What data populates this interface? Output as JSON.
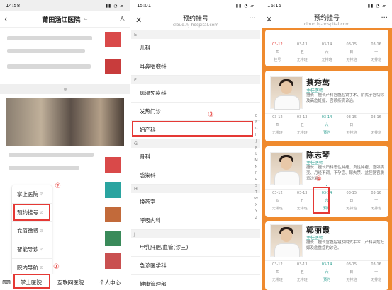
{
  "panel1": {
    "status_time": "14:58",
    "nav_title": "莆田涵江医院",
    "menu_items": [
      "掌上医院",
      "预约挂号",
      "充值缴费",
      "智能导诊",
      "院内导航"
    ],
    "tabs": [
      "掌上医院",
      "互联网医院",
      "个人中心"
    ],
    "num1": "①",
    "num2": "②"
  },
  "panel2": {
    "status_time": "15:01",
    "nav_title": "预约挂号",
    "nav_url": "cloud.hj-hospital.com",
    "sections": [
      {
        "letter": "E",
        "items": [
          "儿科",
          "耳鼻咽喉科"
        ]
      },
      {
        "letter": "F",
        "items": [
          "风湿免疫科",
          "发热门诊",
          "妇产科"
        ]
      },
      {
        "letter": "G",
        "items": [
          "骨科",
          "感染科"
        ]
      },
      {
        "letter": "H",
        "items": [
          "换药室",
          "呼吸内科"
        ]
      },
      {
        "letter": "J",
        "items": [
          "甲乳肝胆/血管(诊三)",
          "急诊医学科",
          "健康管理部"
        ]
      }
    ],
    "index_letters": [
      "E",
      "F",
      "G",
      "H",
      "J",
      "K",
      "L",
      "M",
      "N",
      "P",
      "R",
      "S",
      "T",
      "W",
      "X",
      "Y",
      "Z"
    ],
    "num3": "③"
  },
  "panel3": {
    "status_time": "16:15",
    "nav_title": "预约挂号",
    "nav_url": "cloud.hj-hospital.com",
    "num4": "④",
    "top_schedule": [
      {
        "date": "03-12",
        "day": "四",
        "status": "挂号"
      },
      {
        "date": "03-13",
        "day": "五",
        "status": "无排班"
      },
      {
        "date": "03-14",
        "day": "六",
        "status": "无排班"
      },
      {
        "date": "03-15",
        "day": "日",
        "status": "无排班"
      },
      {
        "date": "03-16",
        "day": "一",
        "status": "无排班"
      }
    ],
    "doctors": [
      {
        "name": "蔡秀莺",
        "title": "主任医师",
        "specialty": "擅长：擅长产科宫腹腔镜手术、阴式子宫切除及高危妊娠、宫颈疾病诊治。",
        "schedule": [
          {
            "date": "03-12",
            "day": "四",
            "status": "无排班"
          },
          {
            "date": "03-13",
            "day": "五",
            "status": "无排班"
          },
          {
            "date": "03-14",
            "day": "六",
            "status": "预约"
          },
          {
            "date": "03-15",
            "day": "日",
            "status": "无排班"
          },
          {
            "date": "03-16",
            "day": "一",
            "status": "无排班"
          }
        ]
      },
      {
        "name": "陈志琴",
        "title": "主任医师",
        "specialty": "擅长：擅长妇科恶性肿瘤、良性肿瘤、宫颈病变、月经不调、不孕症、尿失禁、盆腔器官脱垂诊治。",
        "schedule": [
          {
            "date": "03-12",
            "day": "四",
            "status": "无排班"
          },
          {
            "date": "03-13",
            "day": "五",
            "status": "无排班"
          },
          {
            "date": "03-14",
            "day": "六",
            "status": "预约"
          },
          {
            "date": "03-15",
            "day": "日",
            "status": "无排班"
          },
          {
            "date": "03-16",
            "day": "一",
            "status": "无排班"
          }
        ]
      },
      {
        "name": "郭丽霞",
        "title": "主任医师",
        "specialty": "擅长：擅长宫腹腔镜及阴式手术、产科高危妊娠及危重症的诊治。",
        "schedule": [
          {
            "date": "03-12",
            "day": "四",
            "status": "无排班"
          },
          {
            "date": "03-13",
            "day": "五",
            "status": "无排班"
          },
          {
            "date": "03-14",
            "day": "六",
            "status": "预约"
          },
          {
            "date": "03-15",
            "day": "日",
            "status": "无排班"
          },
          {
            "date": "03-16",
            "day": "一",
            "status": "无排班"
          }
        ]
      }
    ]
  }
}
